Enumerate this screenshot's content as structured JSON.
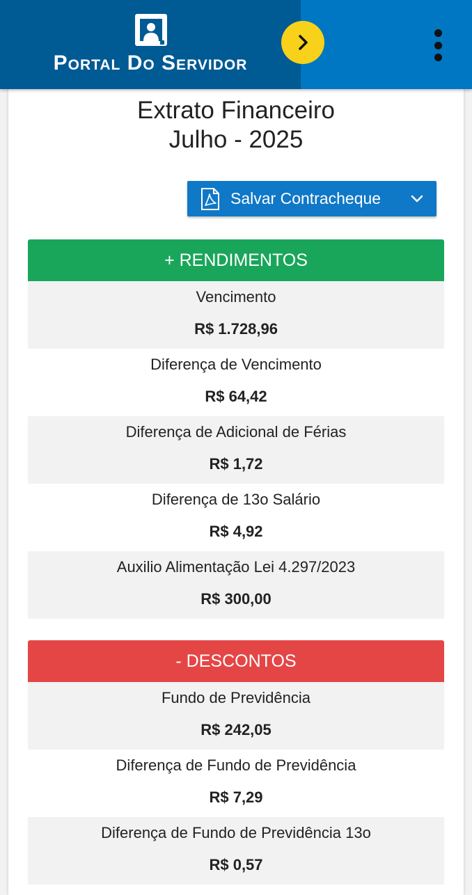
{
  "header": {
    "brand_title": "Portal Do Servidor",
    "nav_toggle_icon": "chevron-right-icon",
    "menu_icon": "more-vertical-icon",
    "colors": {
      "bar": "#0077c2",
      "brand": "#005a94",
      "toggle": "#f7d11a"
    }
  },
  "page": {
    "title_line1": "Extrato Financeiro",
    "title_line2": "Julho - 2025"
  },
  "save_button": {
    "label": "Salvar Contracheque",
    "icon": "pdf-icon",
    "dropdown_icon": "chevron-down-icon"
  },
  "rendimentos": {
    "header": "+ RENDIMENTOS",
    "color": "#1aa65a",
    "items": [
      {
        "label": "Vencimento",
        "value": "R$ 1.728,96"
      },
      {
        "label": "Diferença de Vencimento",
        "value": "R$ 64,42"
      },
      {
        "label": "Diferença de Adicional de Férias",
        "value": "R$ 1,72"
      },
      {
        "label": "Diferença de 13o Salário",
        "value": "R$ 4,92"
      },
      {
        "label": "Auxilio Alimentação Lei 4.297/2023",
        "value": "R$ 300,00"
      }
    ]
  },
  "descontos": {
    "header": "- DESCONTOS",
    "color": "#e44646",
    "items": [
      {
        "label": "Fundo de Previdência",
        "value": "R$ 242,05"
      },
      {
        "label": "Diferença de Fundo de Previdência",
        "value": "R$ 7,29"
      },
      {
        "label": "Diferença de Fundo de Previdência 13o",
        "value": "R$ 0,57"
      }
    ]
  }
}
